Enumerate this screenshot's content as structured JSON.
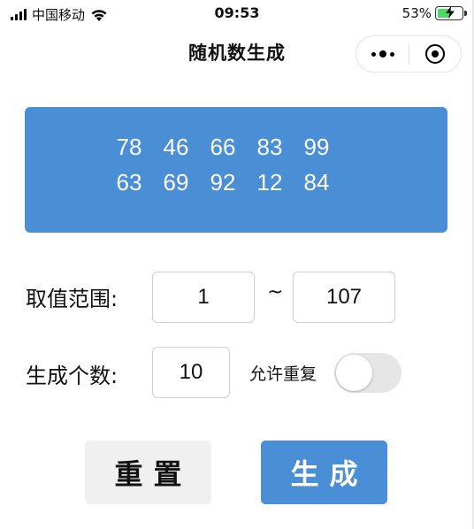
{
  "status_bar": {
    "carrier": "中国移动",
    "time": "09:53",
    "battery_percent": "53%",
    "battery_level": 0.53,
    "battery_color": "#4cd964"
  },
  "nav": {
    "title": "随机数生成",
    "more_icon": "more-dots-icon",
    "close_icon": "target-circle-icon"
  },
  "results": {
    "row1": [
      "78",
      "46",
      "66",
      "83",
      "99"
    ],
    "row2": [
      "63",
      "69",
      "92",
      "12",
      "84"
    ],
    "background": "#4a8fd5"
  },
  "form": {
    "range_label": "取值范围:",
    "range_min": "1",
    "range_separator": "~",
    "range_max": "107",
    "count_label": "生成个数:",
    "count_value": "10",
    "allow_repeat_label": "允许重复",
    "allow_repeat_on": false
  },
  "buttons": {
    "reset_label": "重置",
    "generate_label": "生成",
    "accent": "#4a8fd5"
  }
}
